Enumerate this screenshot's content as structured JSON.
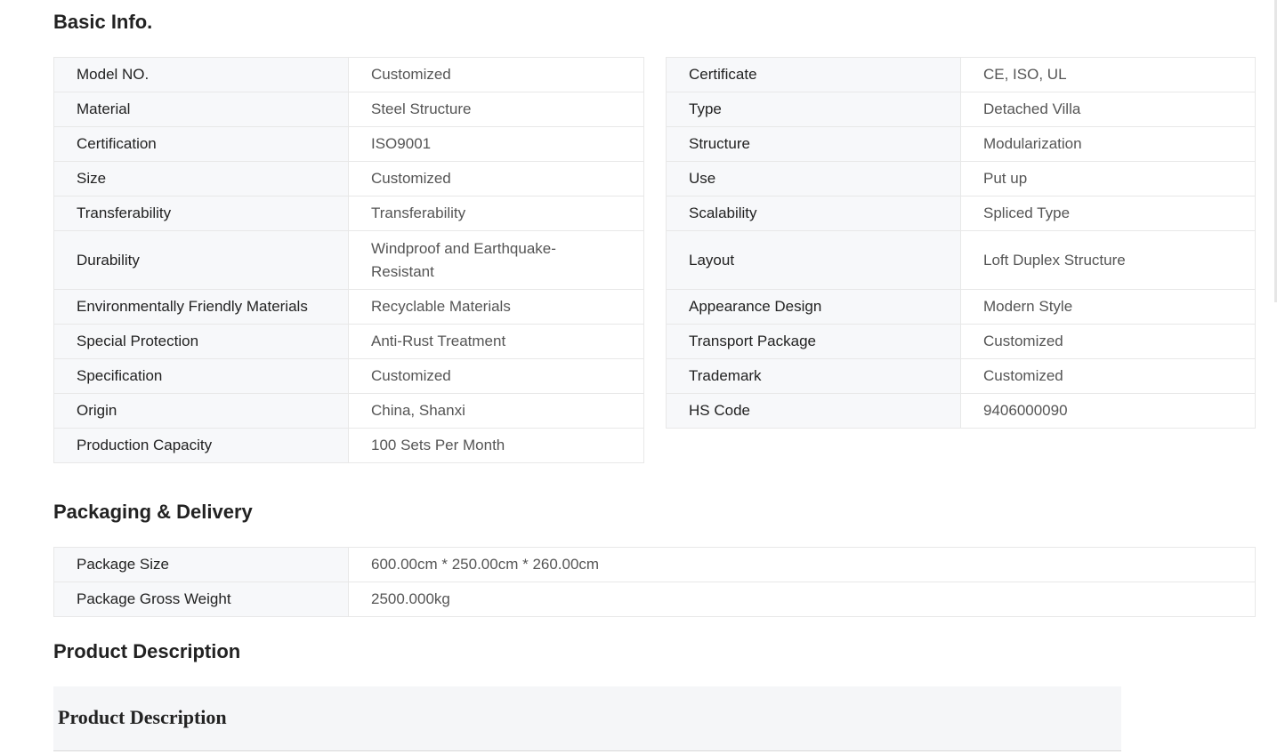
{
  "basic_info": {
    "title": "Basic Info.",
    "left": [
      {
        "key": "Model NO.",
        "value": "Customized"
      },
      {
        "key": "Material",
        "value": "Steel Structure"
      },
      {
        "key": "Certification",
        "value": "ISO9001"
      },
      {
        "key": "Size",
        "value": "Customized"
      },
      {
        "key": "Transferability",
        "value": "Transferability"
      },
      {
        "key": "Durability",
        "value": "Windproof and Earthquake-Resistant"
      },
      {
        "key": "Environmentally Friendly Materials",
        "value": "Recyclable Materials"
      },
      {
        "key": "Special Protection",
        "value": "Anti-Rust Treatment"
      },
      {
        "key": "Specification",
        "value": "Customized"
      },
      {
        "key": "Origin",
        "value": "China, Shanxi"
      },
      {
        "key": "Production Capacity",
        "value": "100 Sets Per Month"
      }
    ],
    "right": [
      {
        "key": "Certificate",
        "value": "CE, ISO, UL"
      },
      {
        "key": "Type",
        "value": "Detached Villa"
      },
      {
        "key": "Structure",
        "value": "Modularization"
      },
      {
        "key": "Use",
        "value": "Put up"
      },
      {
        "key": "Scalability",
        "value": "Spliced Type"
      },
      {
        "key": "Layout",
        "value": "Loft Duplex Structure"
      },
      {
        "key": "Appearance Design",
        "value": "Modern Style"
      },
      {
        "key": "Transport Package",
        "value": "Customized"
      },
      {
        "key": "Trademark",
        "value": "Customized"
      },
      {
        "key": "HS Code",
        "value": "9406000090"
      }
    ]
  },
  "packaging": {
    "title": "Packaging & Delivery",
    "rows": [
      {
        "key": "Package Size",
        "value": "600.00cm * 250.00cm * 260.00cm"
      },
      {
        "key": "Package Gross Weight",
        "value": "2500.000kg"
      }
    ]
  },
  "description": {
    "title": "Product Description",
    "box_heading": "Product Description"
  }
}
